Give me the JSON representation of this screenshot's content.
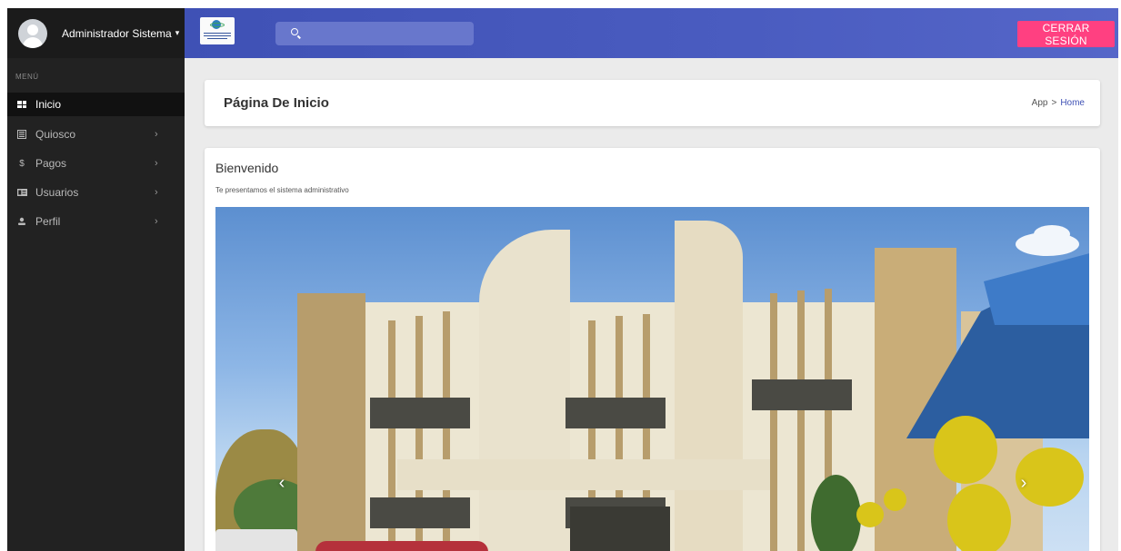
{
  "sidebar": {
    "user_name": "Administrador Sistema",
    "user_caret": "▾",
    "menu_header": "MENÚ",
    "items": [
      {
        "label": "Inicio",
        "icon": "dashboard-icon"
      },
      {
        "label": "Quiosco",
        "icon": "newspaper-icon"
      },
      {
        "label": "Pagos",
        "icon": "dollar-icon"
      },
      {
        "label": "Usuarios",
        "icon": "id-card-icon"
      },
      {
        "label": "Perfil",
        "icon": "person-icon"
      }
    ],
    "chevron": "›",
    "icon_glyphs": {
      "dollar": "$"
    }
  },
  "topbar": {
    "logout_label": "CERRAR SESIÓN",
    "search_placeholder": "",
    "accent_color": "#3f51b5",
    "logout_color": "#ff4081"
  },
  "header": {
    "title": "Página De Inicio",
    "breadcrumb": {
      "app": "App",
      "separator": ">",
      "current": "Home"
    }
  },
  "main": {
    "welcome": "Bienvenido",
    "subtitle": "Te presentamos el sistema administrativo",
    "carousel": {
      "prev": "‹",
      "next": "›"
    }
  }
}
